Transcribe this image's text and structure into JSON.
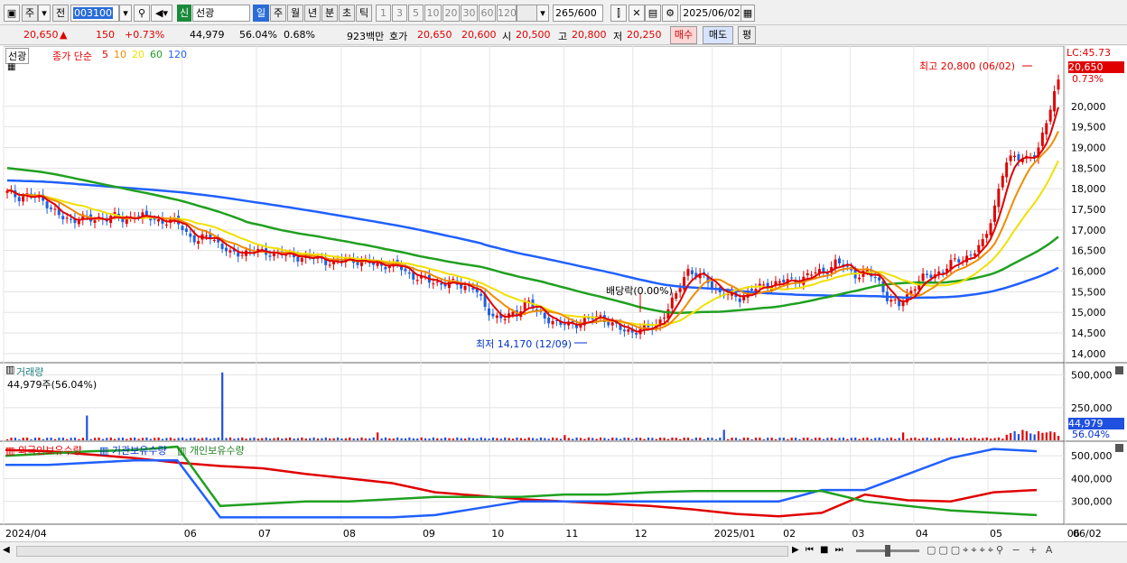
{
  "toolbar": {
    "market_label": "주",
    "market_short": "전",
    "code": "003100",
    "tag": "신",
    "name": "선광",
    "periods": [
      "일",
      "주",
      "월",
      "년",
      "분",
      "초",
      "틱"
    ],
    "period_selected": "일",
    "intervals": [
      "1",
      "3",
      "5",
      "10",
      "20",
      "30",
      "60",
      "120"
    ],
    "count": "265",
    "count_total": "/600",
    "date": "2025/06/02"
  },
  "quote": {
    "price": "20,650",
    "change_icon": "up-triangle",
    "change": "150",
    "change_pct": "+0.73%",
    "volume": "44,979",
    "volume_ratio": "56.04%",
    "turnover_pct": "0.68%",
    "amount": "923백만",
    "bid_label": "호가",
    "ask": "20,650",
    "bid": "20,600",
    "open_label": "시",
    "open": "20,500",
    "high_label": "고",
    "high": "20,800",
    "low_label": "저",
    "low": "20,250",
    "buy_label": "매수",
    "sell_label": "매도",
    "eval_label": "평"
  },
  "price_pane": {
    "title": "선광",
    "ma_label": "종가 단순",
    "ma_periods": [
      "5",
      "10",
      "20",
      "60",
      "120"
    ],
    "ma_colors": [
      "#e00000",
      "#f08c00",
      "#f0e000",
      "#20a020",
      "#2060ff"
    ],
    "lc_label": "LC:45.73",
    "current_badge": "20,650",
    "current_pct": "0.73%",
    "high_note": "최고 20,800 (06/02)",
    "low_note": "최저 14,170 (12/09)",
    "dividend_note": "배당락(0.00%)"
  },
  "volume_pane": {
    "title": "거래량",
    "subtitle": "44,979주(56.04%)",
    "badge": "44,979",
    "badge_pct": "56.04%"
  },
  "holdings_pane": {
    "legend": [
      "외국인보유수량",
      "기관보유수량",
      "개인보유수량"
    ]
  },
  "x_axis": [
    "2024/04",
    "06",
    "07",
    "08",
    "09",
    "10",
    "11",
    "12",
    "2025/01",
    "02",
    "03",
    "04",
    "05",
    "06"
  ],
  "x_right_label": "06/02",
  "chart_data": [
    {
      "type": "candlestick",
      "title": "선광",
      "y_ticks": [
        14000,
        14500,
        15000,
        15500,
        16000,
        16500,
        17000,
        17500,
        18000,
        18500,
        19000,
        19500,
        20000
      ],
      "ylim": [
        13800,
        21200
      ],
      "closes": [
        17900,
        17800,
        17850,
        17750,
        17600,
        17300,
        17200,
        17350,
        17200,
        17300,
        17350,
        17200,
        17400,
        17300,
        17250,
        17200,
        17200,
        16900,
        16700,
        16900,
        16650,
        16400,
        16450,
        16500,
        16450,
        16450,
        16400,
        16350,
        16350,
        16300,
        16250,
        16200,
        16300,
        16250,
        16200,
        16150,
        16150,
        16100,
        15900,
        15800,
        15750,
        15700,
        15700,
        15650,
        15600,
        15100,
        14900,
        14850,
        15000,
        15300,
        14950,
        14850,
        14700,
        14700,
        14750,
        14850,
        14900,
        14700,
        14550,
        14550,
        14600,
        14650,
        15000,
        15400,
        16050,
        15900,
        15750,
        15500,
        15400,
        15350,
        15550,
        15600,
        15700,
        15750,
        15750,
        15850,
        15950,
        16000,
        16200,
        16100,
        15900,
        15950,
        15800,
        15300,
        15150,
        15500,
        15800,
        15900,
        16000,
        16200,
        16300,
        16450,
        16700,
        17600,
        18600,
        18800,
        18750,
        18800,
        19800,
        20650
      ],
      "series": [
        {
          "name": "5",
          "period": 5
        },
        {
          "name": "10",
          "period": 10
        },
        {
          "name": "20",
          "period": 20
        },
        {
          "name": "60",
          "period": 60
        },
        {
          "name": "120",
          "period": 120
        }
      ],
      "ma60_start": 18500,
      "ma120_start": 18200
    },
    {
      "type": "bar",
      "title": "거래량",
      "y_ticks": [
        250000,
        500000
      ],
      "ylim": [
        0,
        560000
      ],
      "spikes": [
        {
          "index": 20,
          "value": 190000
        },
        {
          "index": 54,
          "value": 520000
        },
        {
          "index": 93,
          "value": 60000
        },
        {
          "index": 140,
          "value": 40000
        },
        {
          "index": 180,
          "value": 80000
        },
        {
          "index": 225,
          "value": 60000
        },
        {
          "index": 253,
          "value": 70000
        },
        {
          "index": 255,
          "value": 80000
        },
        {
          "index": 261,
          "value": 60000
        }
      ]
    },
    {
      "type": "line",
      "title": "외국인보유수량 / 기관보유수량 / 개인보유수량",
      "y_ticks": [
        300000,
        400000,
        500000
      ],
      "ylim": [
        200000,
        560000
      ],
      "series": [
        {
          "name": "외국인보유수량",
          "color": "#e00000",
          "values": [
            525000,
            520000,
            505000,
            490000,
            470000,
            455000,
            445000,
            420000,
            400000,
            380000,
            340000,
            325000,
            310000,
            300000,
            290000,
            280000,
            265000,
            245000,
            235000,
            250000,
            330000,
            305000,
            300000,
            340000,
            350000
          ]
        },
        {
          "name": "기관보유수량",
          "color": "#2060ff",
          "values": [
            460000,
            460000,
            470000,
            480000,
            480000,
            230000,
            230000,
            230000,
            230000,
            230000,
            240000,
            270000,
            300000,
            300000,
            300000,
            300000,
            300000,
            300000,
            300000,
            350000,
            350000,
            420000,
            490000,
            530000,
            520000
          ]
        },
        {
          "name": "개인보유수량",
          "color": "#20a020",
          "values": [
            500000,
            510000,
            520000,
            525000,
            540000,
            280000,
            290000,
            300000,
            300000,
            310000,
            320000,
            320000,
            320000,
            330000,
            330000,
            340000,
            345000,
            345000,
            345000,
            345000,
            300000,
            280000,
            260000,
            250000,
            240000
          ]
        }
      ]
    }
  ]
}
